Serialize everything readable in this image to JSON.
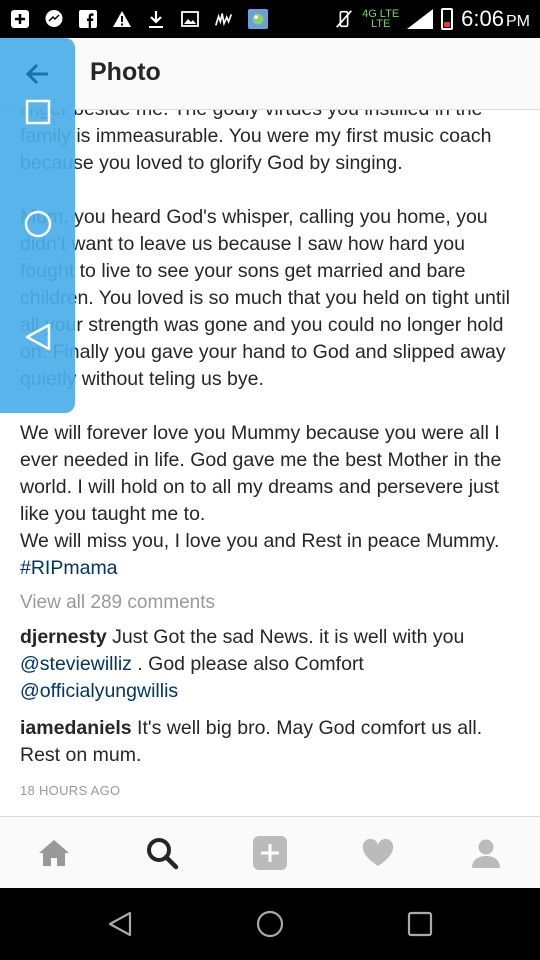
{
  "status_bar": {
    "time": "6:06",
    "ampm": "PM",
    "network_top": "4G LTE",
    "network_bottom": "LTE"
  },
  "header": {
    "title": "Photo"
  },
  "post": {
    "paragraph1": "linger beside me. The godly virtues you instilled in the family is immeasurable. You were my first music coach because you loved to glorify God by singing.",
    "paragraph2": "Mum, you heard God's whisper, calling you home, you didn't want to leave us because I saw how hard you fought to live to see your sons get married and bare children. You loved is so much that you held on tight until all your strength was gone and you could no longer hold on. Finally you gave your hand to God and slipped away quietly without teling us bye.",
    "paragraph3": "We will forever love you Mummy because you were all I ever needed in life. God gave me the best Mother in the world. I will hold on to all my dreams and persevere just like you taught me to.",
    "paragraph4_text": "We will miss you, I love you and Rest in peace Mummy. ",
    "hashtag": "#RIPmama"
  },
  "view_all_comments": "View all 289 comments",
  "comments": [
    {
      "user": "djernesty",
      "text_before": " Just Got the sad News. it is well with you ",
      "mention1": "@steviewilliz",
      "text_middle": " . God please also Comfort ",
      "mention2": "@officialyungwillis"
    },
    {
      "user": "iamedaniels",
      "text": " It's well big bro. May God comfort us all. Rest on mum."
    }
  ],
  "time_ago": "18 HOURS AGO",
  "icons": {
    "back": "arrow-left-icon",
    "home": "home-icon",
    "search": "search-icon",
    "add": "plus-box-icon",
    "activity": "heart-icon",
    "profile": "person-icon"
  },
  "colors": {
    "overlay": "#4aaee8",
    "link": "#003569",
    "muted": "#999999"
  }
}
